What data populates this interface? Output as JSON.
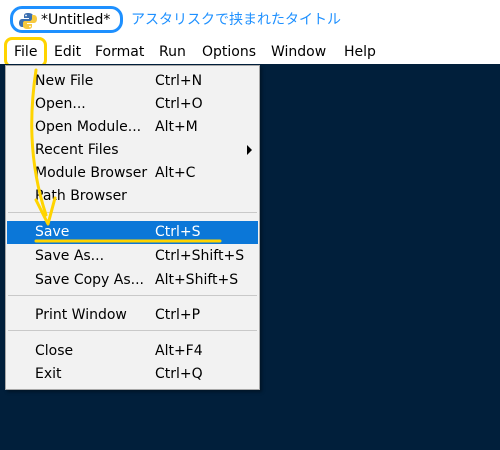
{
  "window": {
    "title": "*Untitled*",
    "annotation": "アスタリスクで挟まれたタイトル",
    "icon": "python-idle-icon"
  },
  "menubar": {
    "items": [
      "File",
      "Edit",
      "Format",
      "Run",
      "Options",
      "Window",
      "Help"
    ]
  },
  "file_menu": {
    "items": [
      {
        "label": "New File",
        "shortcut": "Ctrl+N"
      },
      {
        "label": "Open...",
        "shortcut": "Ctrl+O"
      },
      {
        "label": "Open Module...",
        "shortcut": "Alt+M"
      },
      {
        "label": "Recent Files",
        "shortcut": ""
      },
      {
        "label": "Module Browser",
        "shortcut": "Alt+C"
      },
      {
        "label": "Path Browser",
        "shortcut": ""
      },
      {
        "label": "Save",
        "shortcut": "Ctrl+S"
      },
      {
        "label": "Save As...",
        "shortcut": "Ctrl+Shift+S"
      },
      {
        "label": "Save Copy As...",
        "shortcut": "Alt+Shift+S"
      },
      {
        "label": "Print Window",
        "shortcut": "Ctrl+P"
      },
      {
        "label": "Close",
        "shortcut": "Alt+F4"
      },
      {
        "label": "Exit",
        "shortcut": "Ctrl+Q"
      }
    ],
    "selected": "Save"
  },
  "colors": {
    "editor_background": "#011f3b",
    "selection": "#0b77d8",
    "annotation_blue": "#1e90ff",
    "annotation_yellow": "#ffd400"
  }
}
